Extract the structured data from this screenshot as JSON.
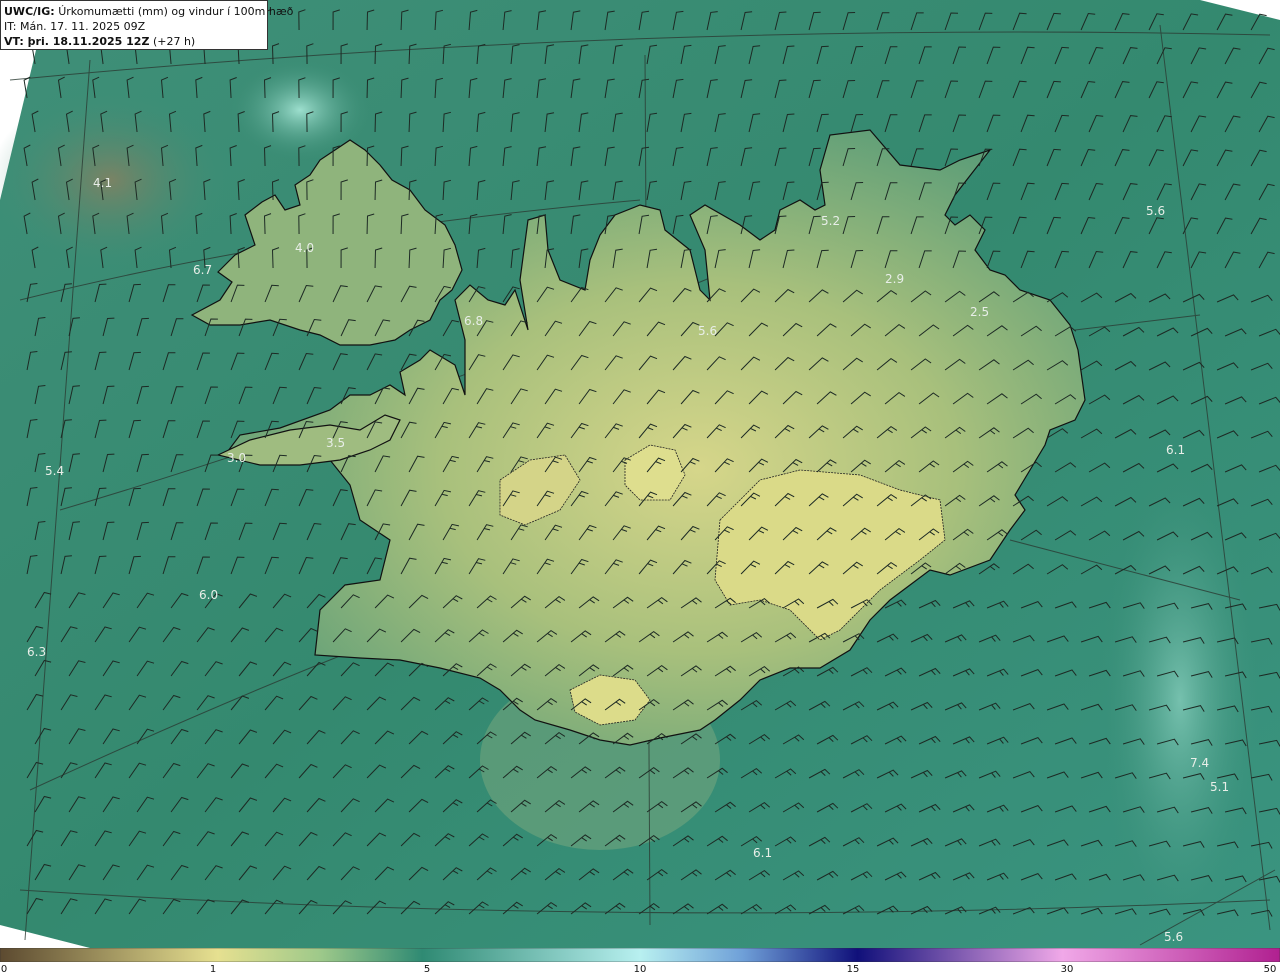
{
  "header": {
    "product": "UWC/IG:",
    "title": "Úrkomumætti (mm) og vindur í 100m hæð",
    "init_time": "IT: Mán. 17. 11. 2025 09Z",
    "valid_prefix": "VT: þri. 18.11.2025 12Z",
    "valid_suffix": "(+27 h)"
  },
  "colorbar": {
    "ticks": [
      "0",
      "1",
      "5",
      "10",
      "15",
      "30",
      "50"
    ],
    "colors": [
      "#6b5a3c",
      "#c9c07a",
      "#e8e590",
      "#2f8a73",
      "#a8e8e0",
      "#1c1c8c",
      "#e080e0",
      "#b02090"
    ]
  },
  "map_values": [
    "4.1",
    "4.0",
    "6.7",
    "6.8",
    "5.6",
    "5.2",
    "2.9",
    "2.5",
    "5.6",
    "3.5",
    "3.0",
    "5.4",
    "6.1",
    "6.0",
    "6.3",
    "7.4",
    "5.1",
    "6.1",
    "5.6"
  ],
  "colors": {
    "sea": "#2f8a73",
    "land_low": "#5fa07a",
    "land_high": "#d8d88a",
    "coast": "#111111"
  }
}
